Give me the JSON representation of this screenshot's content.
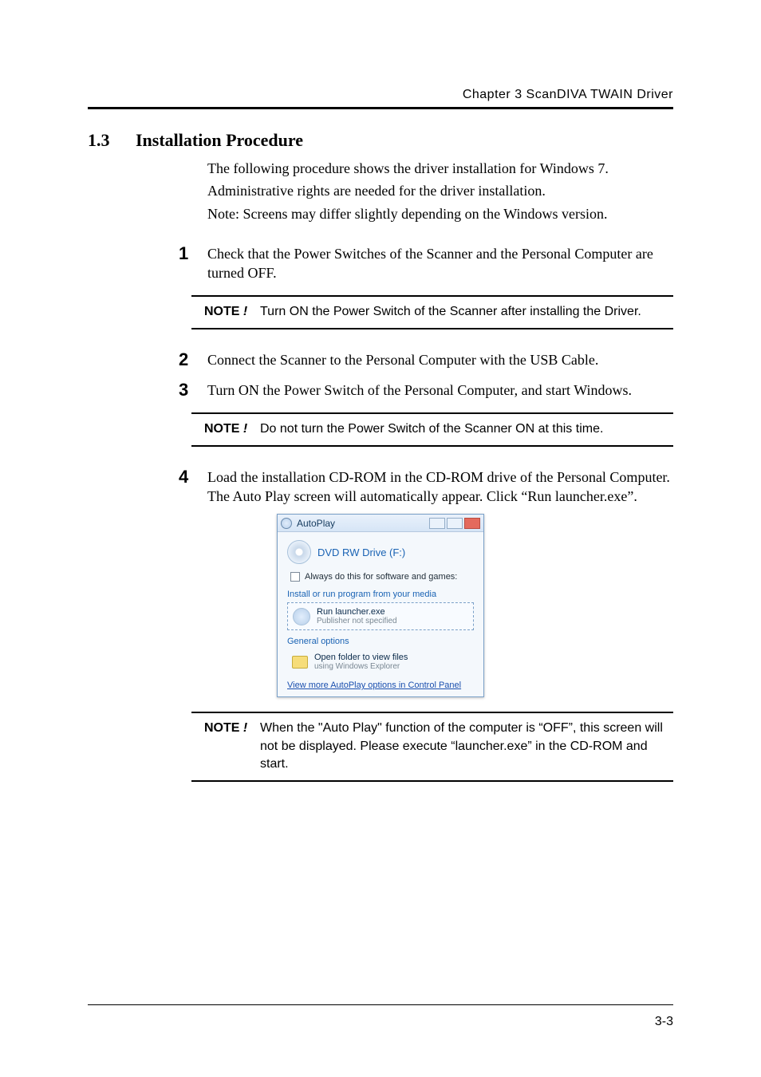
{
  "header": {
    "chapter_line": "Chapter 3 ScanDIVA TWAIN Driver"
  },
  "section": {
    "number": "1.3",
    "title": "Installation Procedure"
  },
  "intro": {
    "line1": "The following procedure shows the driver installation for Windows 7.",
    "line2": "Administrative rights are needed for the driver installation.",
    "line3": "Note: Screens may differ slightly depending on the Windows version."
  },
  "steps": {
    "s1": {
      "num": "1",
      "text": "Check that the Power Switches of the Scanner and the Personal Computer are turned OFF."
    },
    "s2": {
      "num": "2",
      "text": "Connect the Scanner to the Personal Computer with the USB Cable."
    },
    "s3": {
      "num": "3",
      "text": "Turn ON the Power Switch of the Personal Computer, and start Windows."
    },
    "s4": {
      "num": "4",
      "text": "Load the installation CD-ROM in the CD-ROM drive of the Personal Computer. The Auto Play screen will automatically appear. Click “Run launcher.exe”."
    }
  },
  "notes": {
    "label": "NOTE ",
    "bang": "!",
    "n1": "Turn ON the Power Switch of the Scanner after installing the Driver.",
    "n2": "Do not turn the Power Switch of the Scanner ON at this time.",
    "n3": "When the \"Auto Play\" function of the computer is “OFF”, this screen will not be displayed. Please execute “launcher.exe” in the CD-ROM and start."
  },
  "autoplay": {
    "title": "AutoPlay",
    "drive": "DVD RW Drive (F:)",
    "always": "Always do this for software and games:",
    "install_label": "Install or run program from your media",
    "run_line1": "Run launcher.exe",
    "run_line2": "Publisher not specified",
    "general_label": "General options",
    "open_line1": "Open folder to view files",
    "open_line2": "using Windows Explorer",
    "more_link": "View more AutoPlay options in Control Panel"
  },
  "footer": {
    "page": "3-3"
  }
}
